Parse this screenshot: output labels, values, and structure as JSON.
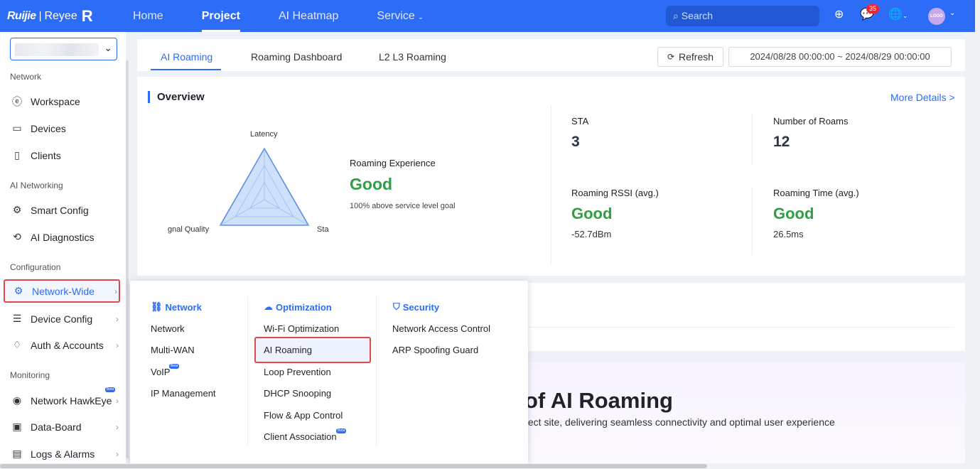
{
  "brand": {
    "name_a": "Ruijie",
    "separator": "|",
    "name_b": "Reyee",
    "mark": "R"
  },
  "topnav": {
    "items": [
      {
        "label": "Home"
      },
      {
        "label": "Project"
      },
      {
        "label": "AI Heatmap"
      },
      {
        "label": "Service"
      }
    ]
  },
  "search": {
    "placeholder": "Search"
  },
  "toolbar": {
    "messages_count": "35",
    "avatar_text": "LOGO"
  },
  "sidebar": {
    "groups": {
      "network": "Network",
      "ai": "AI Networking",
      "config": "Configuration",
      "monitoring": "Monitoring"
    },
    "items": {
      "workspace": "Workspace",
      "devices": "Devices",
      "clients": "Clients",
      "smart_config": "Smart Config",
      "ai_diagnostics": "AI Diagnostics",
      "network_wide": "Network-Wide",
      "device_config": "Device Config",
      "auth_accounts": "Auth & Accounts",
      "network_hawkeye": "Network HawkEye",
      "data_board": "Data-Board",
      "logs_alarms": "Logs & Alarms"
    },
    "beta_label": "Beta"
  },
  "tabs": {
    "ai_roaming": "AI Roaming",
    "dashboard": "Roaming Dashboard",
    "l2l3": "L2 L3 Roaming"
  },
  "refresh_label": "Refresh",
  "date_range": "2024/08/28 00:00:00 ~ 2024/08/29 00:00:00",
  "overview": {
    "title": "Overview",
    "more": "More Details >",
    "radar_labels": {
      "top": "Latency",
      "left": "gnal Quality",
      "right": "Sta"
    },
    "experience_label": "Roaming Experience",
    "experience_value": "Good",
    "experience_sub": "100% above service level goal",
    "sta_label": "STA",
    "sta_value": "3",
    "roams_label": "Number of Roams",
    "roams_value": "12",
    "rssi_label": "Roaming RSSI (avg.)",
    "rssi_value": "Good",
    "rssi_sub": "-52.7dBm",
    "time_label": "Roaming Time (avg.)",
    "time_value": "Good",
    "time_sub": "26.5ms"
  },
  "hero": {
    "title": "of AI Roaming",
    "sub": "oject site, delivering seamless connectivity and optimal user experience"
  },
  "dropdown": {
    "network": {
      "title": "Network",
      "items": [
        "Network",
        "Multi-WAN",
        "VoIP",
        "IP Management"
      ]
    },
    "optimization": {
      "title": "Optimization",
      "items": [
        "Wi-Fi Optimization",
        "AI Roaming",
        "Loop Prevention",
        "DHCP Snooping",
        "Flow & App Control",
        "Client Association"
      ]
    },
    "security": {
      "title": "Security",
      "items": [
        "Network Access Control",
        "ARP Spoofing Guard"
      ]
    }
  }
}
